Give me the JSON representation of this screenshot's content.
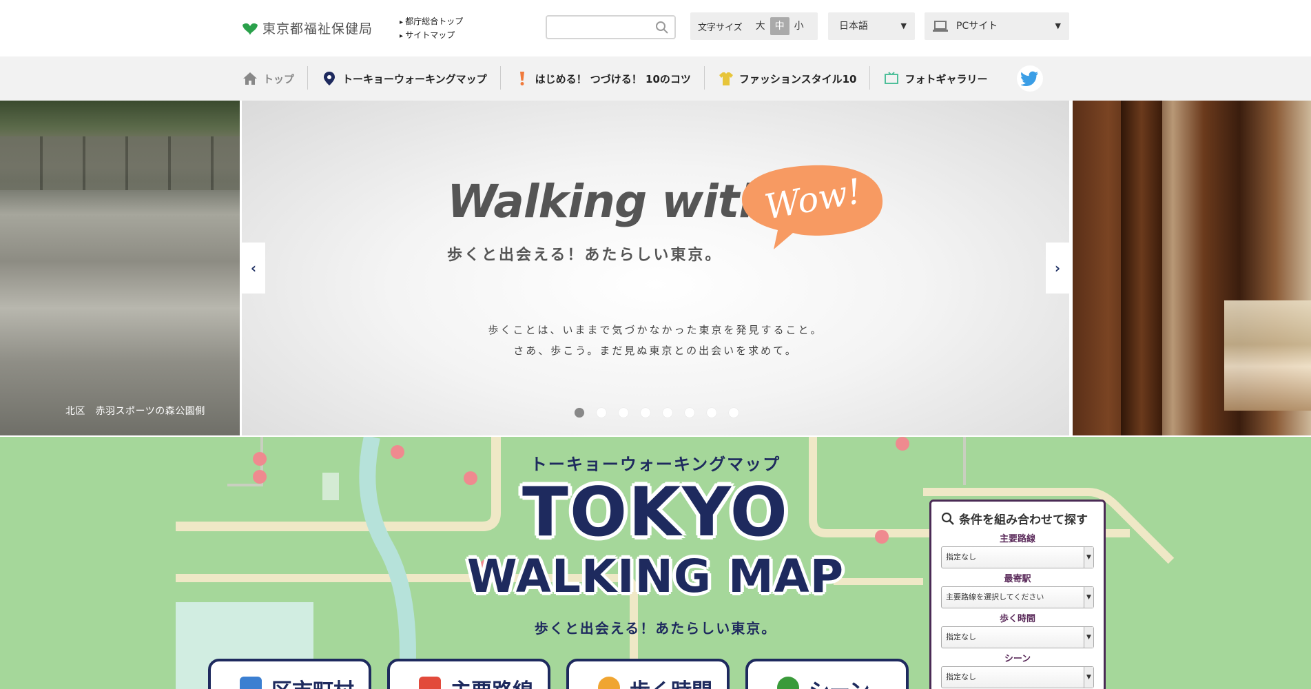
{
  "header": {
    "logo_text": "東京都福祉保健局",
    "links": [
      "都庁総合トップ",
      "サイトマップ"
    ],
    "search_placeholder": "",
    "font_size": {
      "label": "文字サイズ",
      "options": [
        "大",
        "中",
        "小"
      ],
      "active": "中"
    },
    "language": "日本語",
    "site_mode": "PCサイト"
  },
  "nav": {
    "items": [
      {
        "label": "トップ",
        "icon": "home-icon"
      },
      {
        "label": "トーキョーウォーキングマップ",
        "icon": "map-pin-icon"
      },
      {
        "label": "はじめる！ つづける！ 10のコツ",
        "icon": "exclamation-icon"
      },
      {
        "label": "ファッションスタイル10",
        "icon": "shirt-icon"
      },
      {
        "label": "フォトギャラリー",
        "icon": "photo-icon"
      }
    ],
    "twitter_icon": "twitter-icon"
  },
  "hero": {
    "title": "Walking with",
    "bubble": "Wow!",
    "subtitle": "歩くと出会える！あたらしい東京。",
    "body_line1": "歩くことは、いままで気づかなかった東京を発見すること。",
    "body_line2": "さあ、歩こう。まだ見ぬ東京との出会いを求めて。",
    "left_caption": "北区　赤羽スポーツの森公園側",
    "slide_count": 8,
    "active_slide": 1,
    "colors": {
      "bubble": "#f79a62",
      "title": "#555555"
    }
  },
  "map": {
    "kana_title": "トーキョーウォーキングマップ",
    "title_line1": "TOKYO",
    "title_line2": "WALKING MAP",
    "subtitle": "歩くと出会える！あたらしい東京。",
    "tiles": [
      {
        "label": "区市町村",
        "color": "#3b7fd1"
      },
      {
        "label": "主要路線",
        "color": "#e24a3b"
      },
      {
        "label": "歩く時間",
        "color": "#f0a531"
      },
      {
        "label": "シーン",
        "color": "#3a9a3a"
      }
    ],
    "search_panel": {
      "title": "条件を組み合わせて探す",
      "fields": [
        {
          "label": "主要路線",
          "value": "指定なし"
        },
        {
          "label": "最寄駅",
          "value": "主要路線を選択してください"
        },
        {
          "label": "歩く時間",
          "value": "指定なし"
        },
        {
          "label": "シーン",
          "value": "指定なし"
        }
      ]
    },
    "colors": {
      "background": "#a5d79a",
      "navy": "#1e2a5e"
    }
  }
}
